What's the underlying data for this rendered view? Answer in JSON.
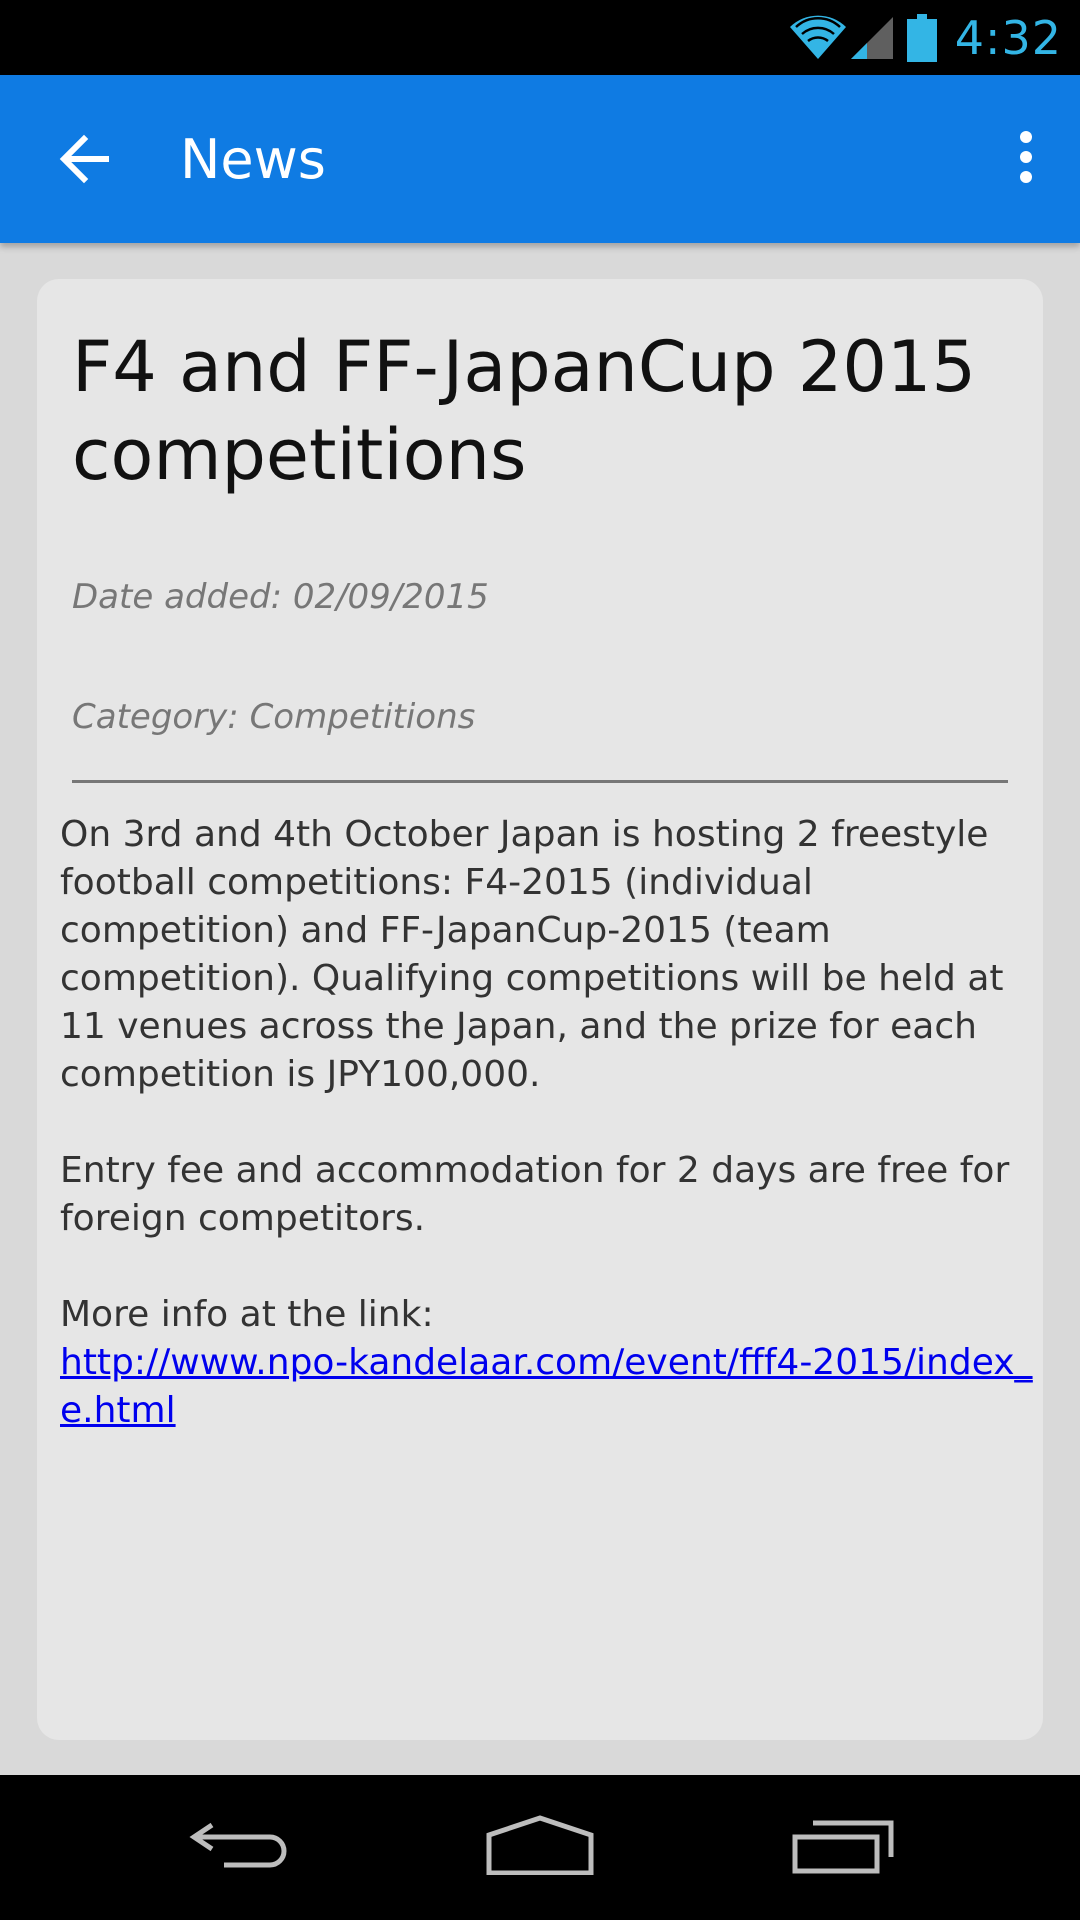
{
  "status_bar": {
    "time": "4:32",
    "icons": [
      "wifi-icon",
      "cell-signal-icon",
      "battery-icon"
    ],
    "accent_color": "#33b5e5"
  },
  "app_bar": {
    "title": "News",
    "back_icon": "arrow-back-icon",
    "menu_icon": "more-vert-icon",
    "color": "#0f7be3"
  },
  "article": {
    "title": "F4 and FF-JapanCup 2015 competitions",
    "date_added": "Date added: 02/09/2015",
    "category": "Category: Competitions",
    "paragraphs": [
      "On 3rd and 4th October Japan is hosting 2 freestyle football competitions: F4-2015 (individual competition) and FF-JapanCup-2015 (team competition). Qualifying competitions will be held at 11 venues across the Japan, and the prize for each competition is JPY100,000.",
      "Entry fee and accommodation for 2 days are free for foreign competitors."
    ],
    "more_info_label": "More info at the link:",
    "link_text": "http://www.npo-kandelaar.com/event/fff4-2015/index_e.html "
  },
  "nav_bar": {
    "icons": [
      "nav-back-icon",
      "nav-home-icon",
      "nav-recents-icon"
    ]
  }
}
